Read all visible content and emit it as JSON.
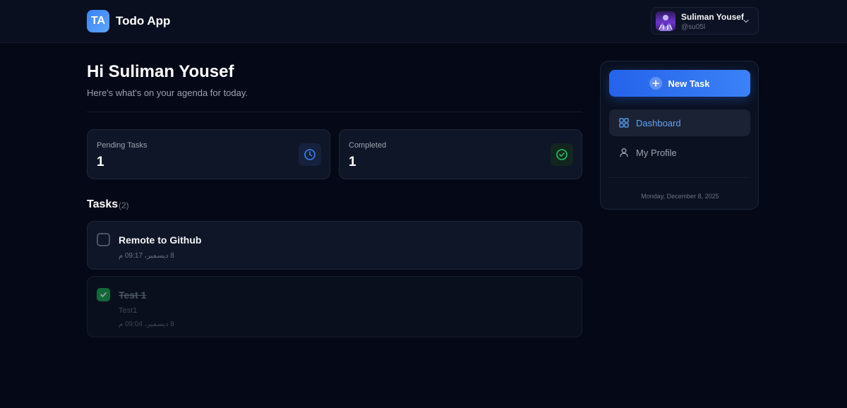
{
  "header": {
    "logo_text": "TA",
    "app_name": "Todo App",
    "user": {
      "name": "Suliman Yousef",
      "handle": "@su05l"
    }
  },
  "main": {
    "greeting": "Hi Suliman Yousef",
    "subtitle": "Here's what's on your agenda for today.",
    "stats": [
      {
        "label": "Pending Tasks",
        "value": "1",
        "icon": "clock-icon",
        "color": "#3b82f6"
      },
      {
        "label": "Completed",
        "value": "1",
        "icon": "check-circle-icon",
        "color": "#22c55e"
      }
    ],
    "tasks_heading": "Tasks",
    "tasks_count": "(2)",
    "tasks": [
      {
        "title": "Remote to Github",
        "description": "",
        "time": "8 ديسمبر، 09:17 م",
        "completed": false
      },
      {
        "title": "Test 1",
        "description": "Test1",
        "time": "8 ديسمبر، 09:04 م",
        "completed": true
      }
    ]
  },
  "sidebar": {
    "new_task_label": "New Task",
    "nav": [
      {
        "label": "Dashboard",
        "icon": "grid-icon",
        "active": true
      },
      {
        "label": "My Profile",
        "icon": "user-icon",
        "active": false
      }
    ],
    "date": "Monday, December 8, 2025"
  },
  "colors": {
    "accent": "#3b82f6",
    "success": "#22c55e",
    "background": "#050816"
  }
}
